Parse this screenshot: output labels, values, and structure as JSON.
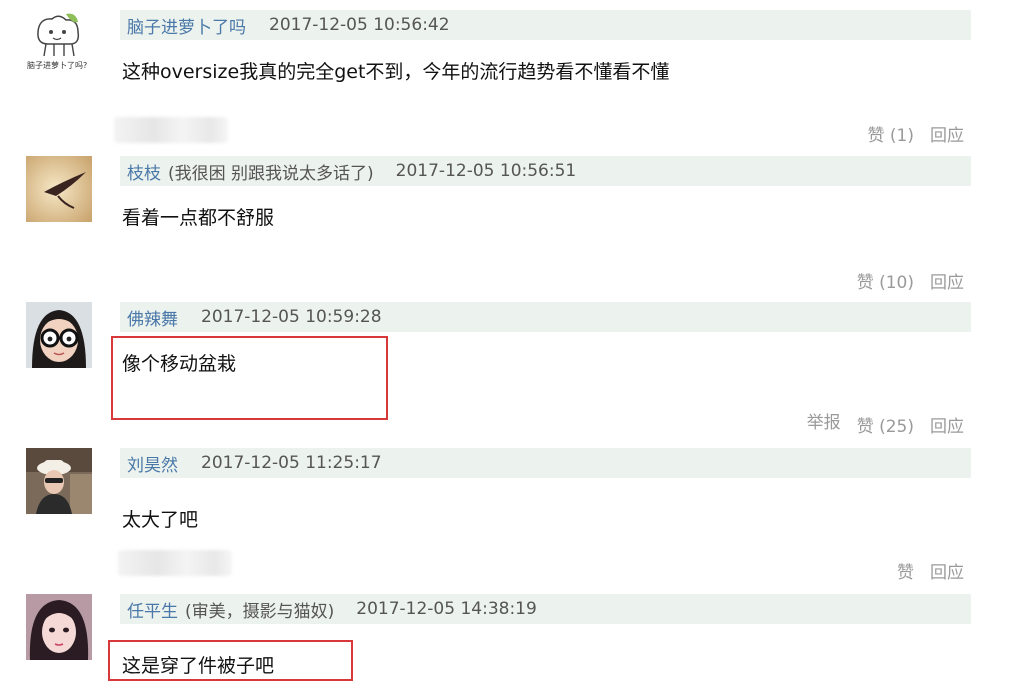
{
  "comments": [
    {
      "username": "脑子进萝卜了吗",
      "signature": "",
      "timestamp": "2017-12-05 10:56:42",
      "text": "这种oversize我真的完全get不到，今年的流行趋势看不懂看不懂",
      "actions": {
        "report": "",
        "like": "赞 (1)",
        "reply": "回应"
      },
      "avatar_caption": "脑子进萝卜了吗?"
    },
    {
      "username": "枝枝",
      "signature": "(我很困 别跟我说太多话了)",
      "timestamp": "2017-12-05 10:56:51",
      "text": "看着一点都不舒服",
      "actions": {
        "report": "",
        "like": "赞 (10)",
        "reply": "回应"
      }
    },
    {
      "username": "佛辣舞",
      "signature": "",
      "timestamp": "2017-12-05 10:59:28",
      "text": "像个移动盆栽",
      "actions": {
        "report": "举报",
        "like": "赞 (25)",
        "reply": "回应"
      }
    },
    {
      "username": "刘昊然",
      "signature": "",
      "timestamp": "2017-12-05 11:25:17",
      "text": "太大了吧",
      "actions": {
        "report": "",
        "like": "赞",
        "reply": "回应"
      }
    },
    {
      "username": "任平生",
      "signature": "(审美，摄影与猫奴)",
      "timestamp": "2017-12-05 14:38:19",
      "text": "这是穿了件被子吧",
      "actions": {
        "report": "",
        "like": "",
        "reply": ""
      }
    }
  ],
  "colors": {
    "meta_bar_bg": "#ecf2ee",
    "username": "#4a78a8",
    "action_text": "#9a9a9a",
    "highlight": "#d9383a"
  }
}
